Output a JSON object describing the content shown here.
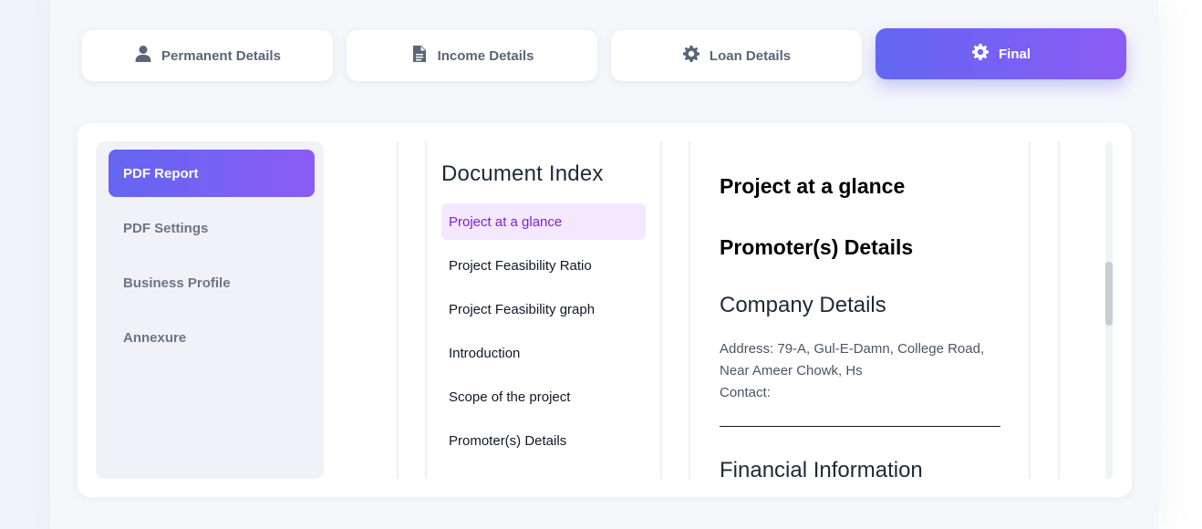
{
  "tabs": [
    {
      "label": "Permanent Details",
      "icon": "user-icon"
    },
    {
      "label": "Income Details",
      "icon": "document-icon"
    },
    {
      "label": "Loan Details",
      "icon": "gear-icon"
    },
    {
      "label": "Final",
      "icon": "gear-icon",
      "active": true
    }
  ],
  "sidebar": {
    "items": [
      {
        "label": "PDF Report",
        "active": true
      },
      {
        "label": "PDF Settings"
      },
      {
        "label": "Business Profile"
      },
      {
        "label": "Annexure"
      }
    ]
  },
  "index": {
    "title": "Document Index",
    "items": [
      {
        "label": "Project at a glance",
        "active": true
      },
      {
        "label": "Project Feasibility Ratio"
      },
      {
        "label": "Project Feasibility graph"
      },
      {
        "label": "Introduction"
      },
      {
        "label": "Scope of the project"
      },
      {
        "label": "Promoter(s) Details"
      }
    ]
  },
  "preview": {
    "heading1": "Project at a glance",
    "heading2": "Promoter(s) Details",
    "company_title": "Company Details",
    "address_line1": "Address: 79-A, Gul-E-Damn, College Road,",
    "address_line2": "Near Ameer Chowk, Hs",
    "contact": "Contact:",
    "financial_title": "Financial Information"
  },
  "colors": {
    "accent_start": "#6366f1",
    "accent_end": "#8b5cf6",
    "index_active_bg": "#f3e8ff",
    "index_active_text": "#7e22ce"
  }
}
